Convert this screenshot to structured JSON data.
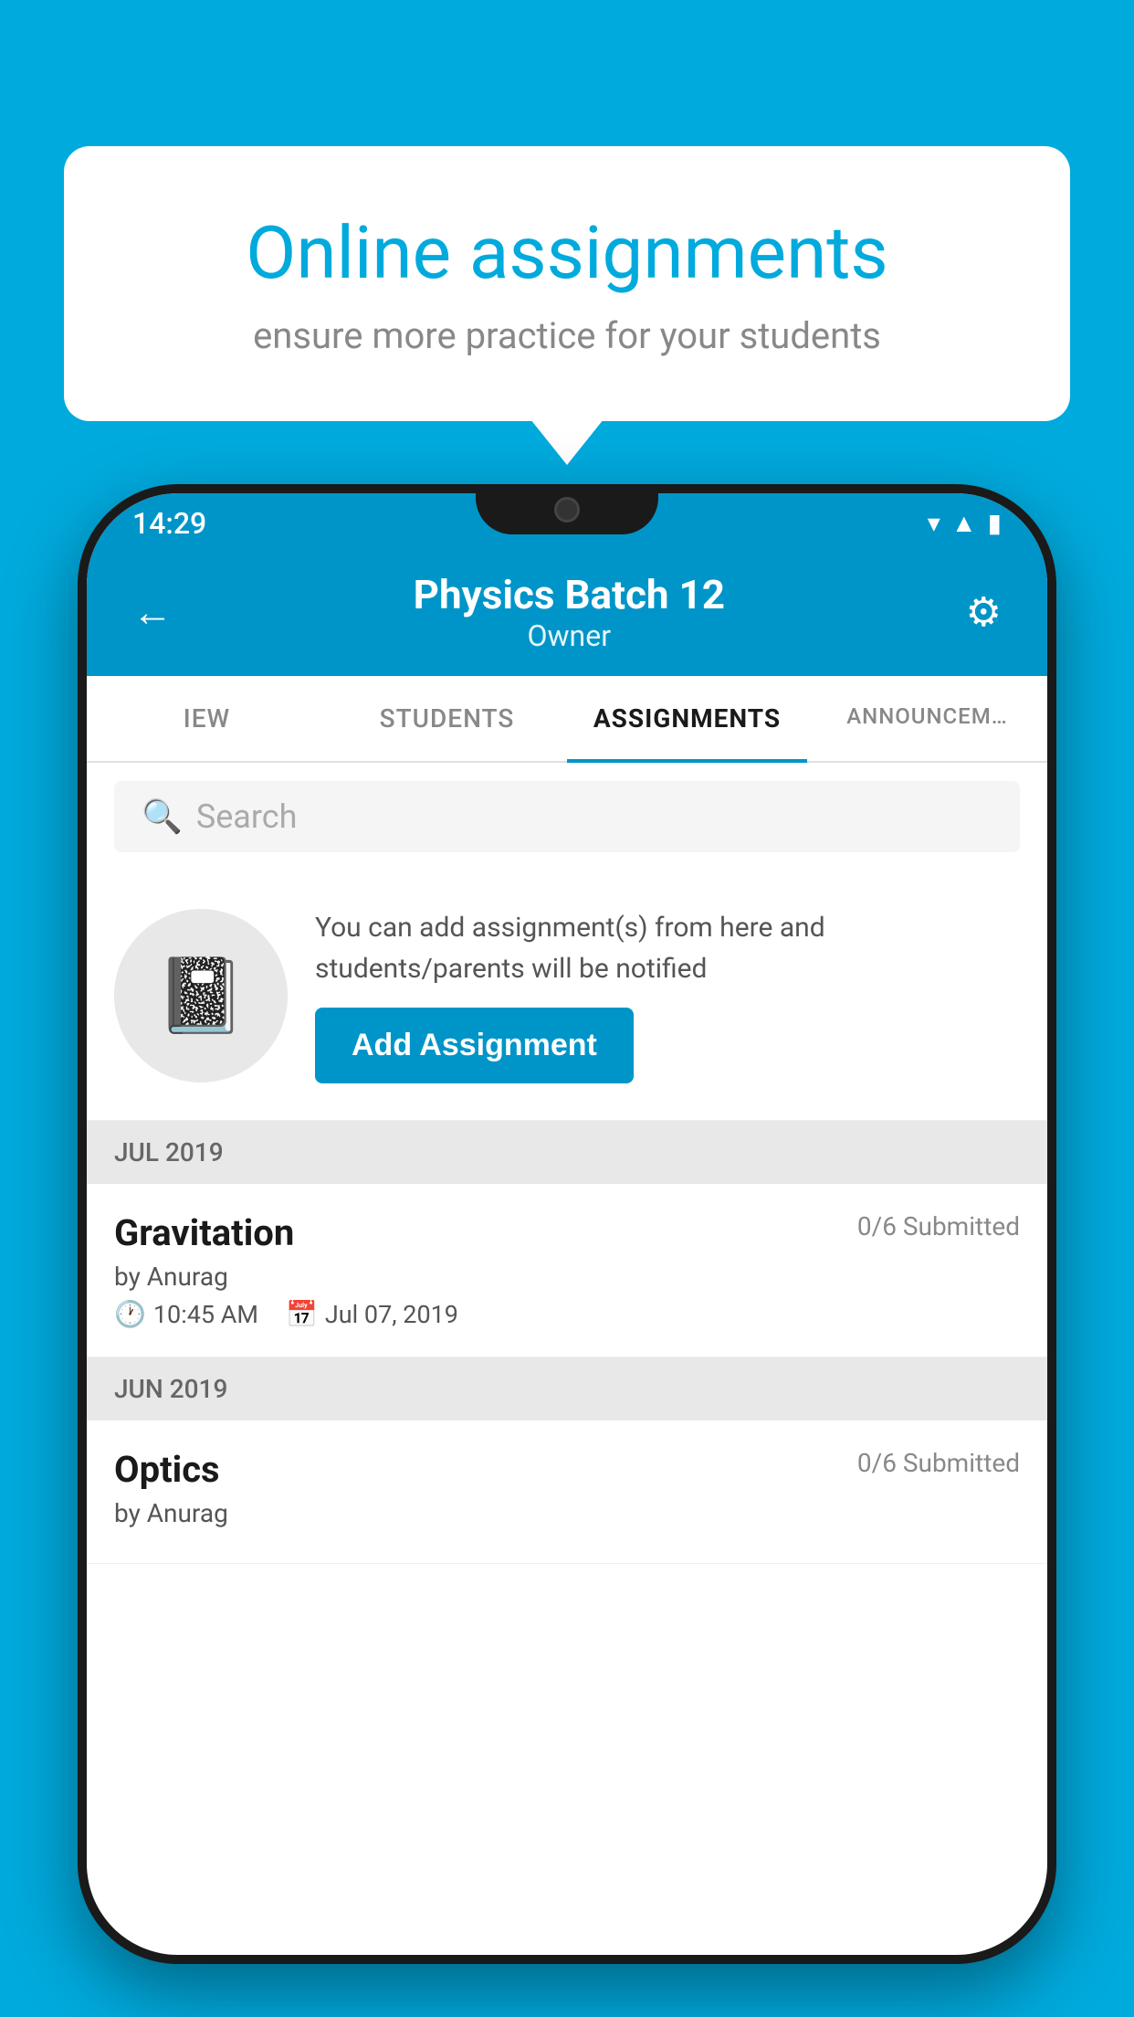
{
  "background": {
    "color": "#00AADD"
  },
  "speech_bubble": {
    "title": "Online assignments",
    "subtitle": "ensure more practice for your students"
  },
  "phone": {
    "status_bar": {
      "time": "14:29",
      "icons": [
        "wifi",
        "signal",
        "battery"
      ]
    },
    "header": {
      "title": "Physics Batch 12",
      "subtitle": "Owner",
      "back_label": "←",
      "settings_label": "⚙"
    },
    "tabs": [
      {
        "label": "IEW",
        "active": false
      },
      {
        "label": "STUDENTS",
        "active": false
      },
      {
        "label": "ASSIGNMENTS",
        "active": true
      },
      {
        "label": "ANNOUNCEM…",
        "active": false
      }
    ],
    "search": {
      "placeholder": "Search"
    },
    "promo": {
      "icon": "📓",
      "text": "You can add assignment(s) from here and students/parents will be notified",
      "button_label": "Add Assignment"
    },
    "sections": [
      {
        "label": "JUL 2019",
        "assignments": [
          {
            "name": "Gravitation",
            "submitted": "0/6 Submitted",
            "by": "by Anurag",
            "time": "10:45 AM",
            "date": "Jul 07, 2019"
          }
        ]
      },
      {
        "label": "JUN 2019",
        "assignments": [
          {
            "name": "Optics",
            "submitted": "0/6 Submitted",
            "by": "by Anurag",
            "time": "",
            "date": ""
          }
        ]
      }
    ]
  }
}
